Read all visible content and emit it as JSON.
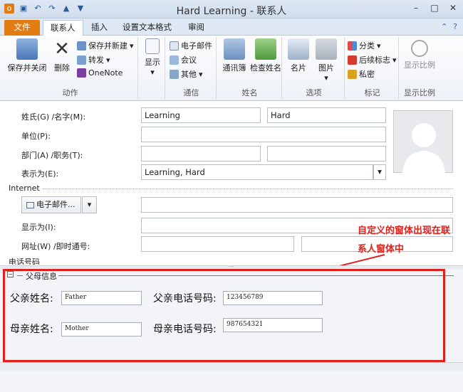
{
  "window": {
    "title": "Hard Learning - 联系人",
    "qat_icons": [
      "outlook-icon",
      "save-icon",
      "undo-icon",
      "redo-icon",
      "up-icon",
      "down-icon"
    ],
    "controls": [
      "minimize-icon",
      "maximize-icon",
      "close-icon"
    ]
  },
  "ribbon": {
    "tabs": [
      "文件",
      "联系人",
      "插入",
      "设置文本格式",
      "审阅"
    ],
    "groups": {
      "actions": {
        "label": "动作",
        "save_close": "保存并关闭",
        "delete": "删除",
        "save_new": "保存并新建",
        "forward": "转发",
        "onenote": "OneNote"
      },
      "show": {
        "label": "显示"
      },
      "communicate": {
        "label": "通信",
        "email": "电子邮件",
        "meeting": "会议",
        "more": "其他"
      },
      "names": {
        "label": "姓名",
        "address_book": "通讯簿",
        "check_names": "检查姓名"
      },
      "options": {
        "label": "选项",
        "business_card": "名片",
        "picture": "图片"
      },
      "tags": {
        "label": "标记",
        "categorize": "分类",
        "follow_up": "后续标志",
        "private": "私密"
      },
      "zoom": {
        "label": "显示比例",
        "zoom": "显示比例"
      }
    }
  },
  "form": {
    "name_label": "姓氏(G) /名字(M):",
    "last_name": "Learning",
    "first_name": "Hard",
    "company_label": "单位(P):",
    "dept_label": "部门(A) /职务(T):",
    "display_as_label": "表示为(E):",
    "display_as_value": "Learning, Hard",
    "internet_section": "Internet",
    "email_button": "电子邮件...",
    "email_display_label": "显示为(I):",
    "web_label": "网址(W) /即时通号:",
    "phone_section": "电话号码"
  },
  "annotation": {
    "line1": "自定义的窗体出现在联",
    "line2": "系人窗体中"
  },
  "custom_region": {
    "group_title": "父母信息",
    "father_name_label": "父亲姓名:",
    "father_name": "Father",
    "father_phone_label": "父亲电话号码:",
    "father_phone": "123456789",
    "mother_name_label": "母亲姓名:",
    "mother_name": "Mother",
    "mother_phone_label": "母亲电话号码:",
    "mother_phone": "987654321"
  }
}
